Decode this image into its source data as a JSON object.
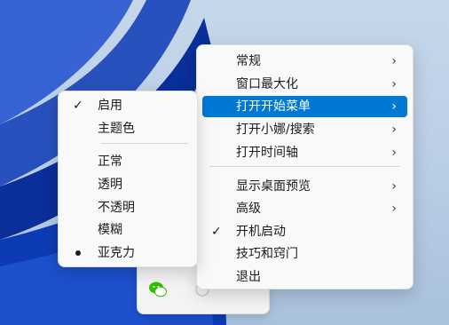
{
  "main_menu": {
    "items": [
      {
        "label": "常规",
        "submenu": true
      },
      {
        "label": "窗口最大化",
        "submenu": true
      },
      {
        "label": "打开开始菜单",
        "submenu": true,
        "active": true
      },
      {
        "label": "打开小娜/搜索",
        "submenu": true
      },
      {
        "label": "打开时间轴",
        "submenu": true
      },
      {
        "label": "显示桌面预览",
        "submenu": true
      },
      {
        "label": "高级",
        "submenu": true
      },
      {
        "label": "开机启动",
        "checked": true
      },
      {
        "label": "技巧和窍门"
      },
      {
        "label": "退出"
      }
    ]
  },
  "sub_menu": {
    "items": [
      {
        "label": "启用",
        "checked": true
      },
      {
        "label": "主题色"
      },
      {
        "label": "正常"
      },
      {
        "label": "透明"
      },
      {
        "label": "不透明"
      },
      {
        "label": "模糊"
      },
      {
        "label": "亚克力",
        "radio": true
      }
    ]
  },
  "colors": {
    "highlight": "#0078d4",
    "menu_bg": "#f9f9f9",
    "wallpaper_blue": "#0a3ec2"
  },
  "icons": {
    "check": "checkmark-icon",
    "chevron": "chevron-right-icon",
    "radio": "radio-dot-icon",
    "tray_app": "wechat-icon"
  }
}
